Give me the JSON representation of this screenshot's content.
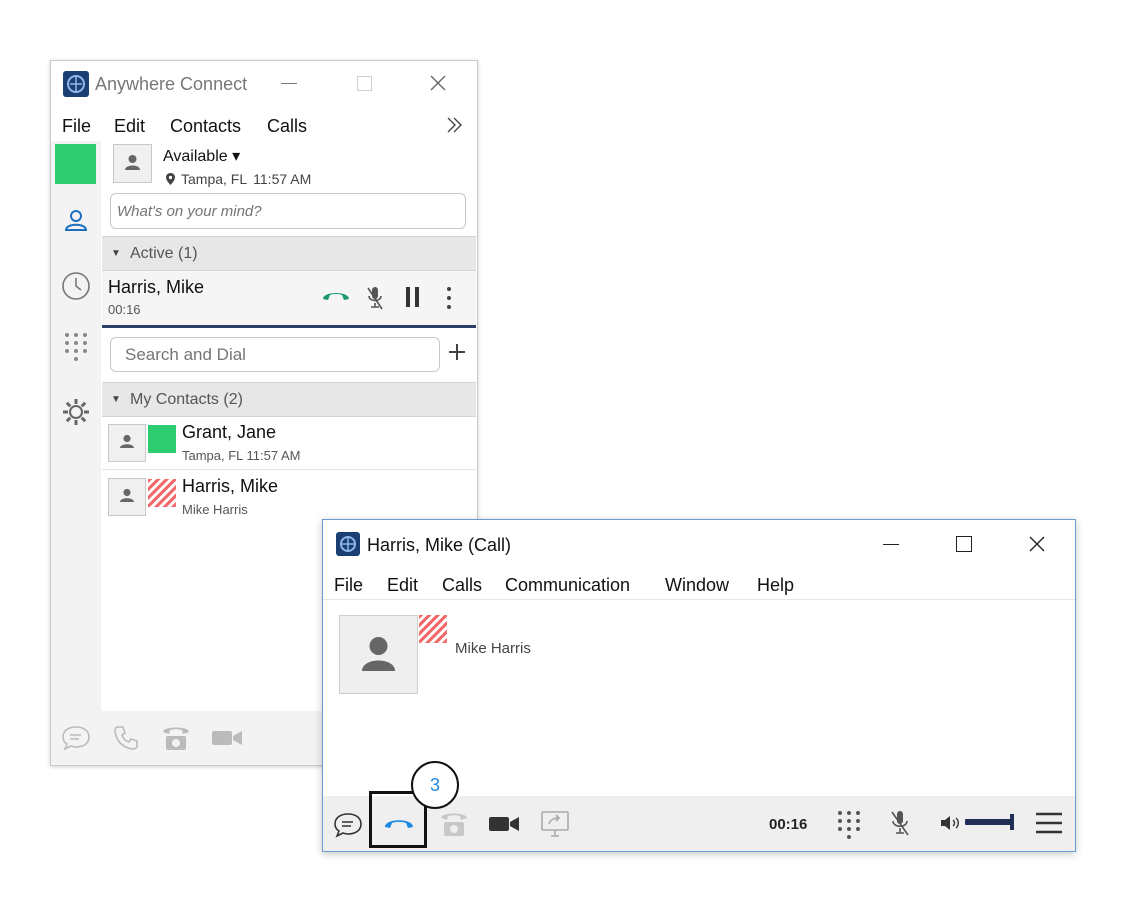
{
  "main": {
    "title": "Anywhere Connect",
    "menu": [
      "File",
      "Edit",
      "Contacts",
      "Calls"
    ],
    "overflow_icon": "double-chevron-right-icon",
    "presence": {
      "status": "Available ▾",
      "location": "Tampa, FL",
      "time": "11:57 AM",
      "status_color": "#2ecc71"
    },
    "mind_placeholder": "What's on your mind?",
    "active_section": "Active (1)",
    "active_call": {
      "name": "Harris, Mike",
      "duration": "00:16"
    },
    "search_placeholder": "Search and Dial",
    "contacts_section": "My Contacts (2)",
    "contacts": [
      {
        "name": "Grant, Jane",
        "sub": "Tampa, FL  11:57 AM",
        "presence": "available"
      },
      {
        "name": "Harris, Mike",
        "sub": "Mike Harris",
        "presence": "busy"
      }
    ]
  },
  "call_window": {
    "title": "Harris, Mike (Call)",
    "menu": [
      "File",
      "Edit",
      "Calls",
      "Communication",
      "Window",
      "Help"
    ],
    "contact_name": "Mike Harris",
    "timer": "00:16",
    "callout_number": "3",
    "hangup_color": "#1e88e5"
  },
  "colors": {
    "available": "#2ecc71",
    "busy": "#f26b6b",
    "accent": "#1e6fbf"
  }
}
